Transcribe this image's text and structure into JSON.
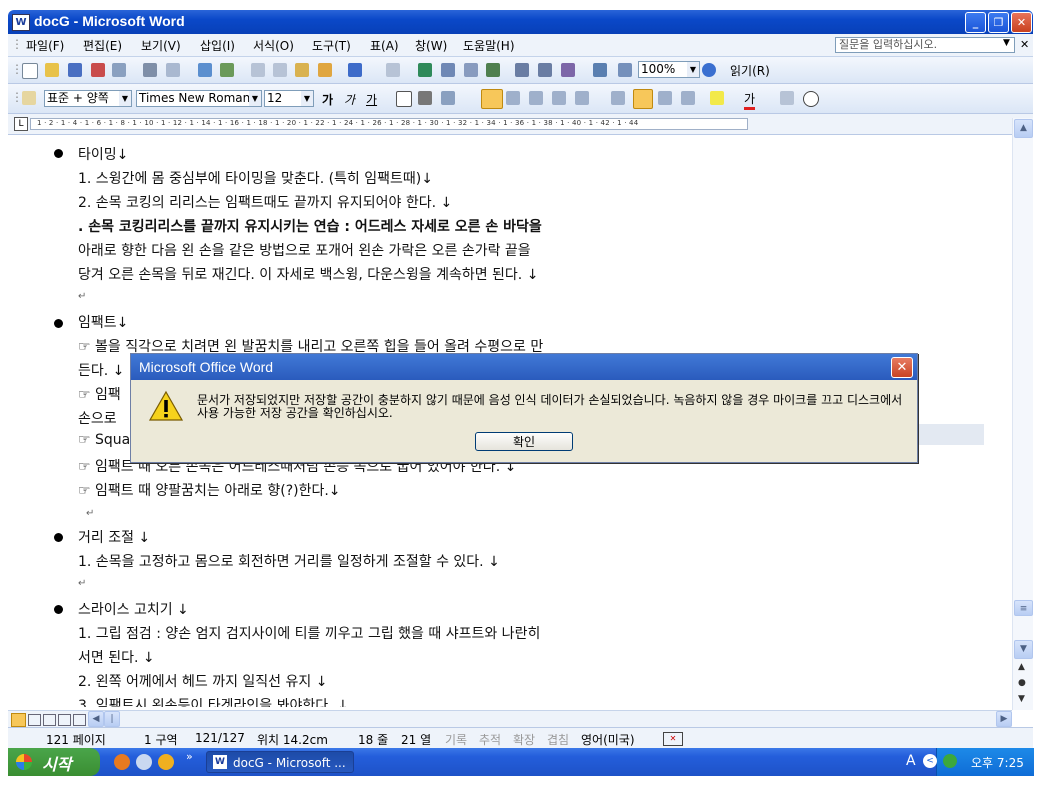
{
  "window": {
    "title": "docG - Microsoft Word",
    "app_icon": "W"
  },
  "menubar": {
    "items": [
      "파일(F)",
      "편집(E)",
      "보기(V)",
      "삽입(I)",
      "서식(O)",
      "도구(T)",
      "표(A)",
      "창(W)",
      "도움말(H)"
    ],
    "ask_placeholder": "질문을 입력하십시오."
  },
  "toolbar": {
    "zoom": "100%",
    "read_label": "읽기(R)"
  },
  "format_toolbar": {
    "style": "표준 + 양쪽",
    "font": "Times New Roman",
    "size": "12",
    "bold": "가",
    "italic": "가",
    "underline": "가",
    "highlight_label": "가"
  },
  "ruler": {
    "marks": "1 · 2 · 1 · 4 · 1 · 6 · 1 · 8 · 1 · 10 · 1 · 12 · 1 · 14 · 1 · 16 · 1 · 18 · 1 · 20 · 1 · 22 · 1 · 24 · 1 · 26 · 1 · 28 · 1 · 30 · 1 · 32 · 1 · 34 · 1 · 36 · 1 · 38 · 1 · 40 · 1 · 42 · 1 · 44"
  },
  "document": {
    "lines": [
      "타이밍↓",
      "1. 스윙간에 몸 중심부에 타이밍을 맞춘다. (특히 임팩트때)↓",
      "2. 손목 코킹의 리리스는 임팩트때도 끝까지 유지되어야 한다. ↓",
      " . 손목 코킹리리스를 끝까지 유지시키는 연습 : 어드레스 자세로 오른 손 바닥을",
      "아래로 향한 다음 왼 손을 같은 방법으로 포개어 왼손 가락은 오른 손가락 끝을",
      "당겨 오른 손목을 뒤로 재긴다. 이 자세로 백스윙, 다운스윙을 계속하면 된다.    ↓",
      "↵",
      "임팩트↓",
      "☞ 볼을 직각으로 치려면 왼 발꿈치를 내리고 오른쪽 힙을 들어 올려 수평으로 만",
      "든다. ↓",
      "☞ 임팩",
      "손으로",
      "☞ Squa",
      "☞ 임팩트 때 오른 손목은 어드레스때처럼 손등 쪽으로 굽어 있어야 한다.   ↓",
      "☞ 임팩트 때 양팔꿈치는 아래로 향(?)한다.↓",
      "↵",
      "거리 조절 ↓",
      "1. 손목을 고정하고 몸으로 회전하면 거리를 일정하게 조절할 수 있다. ↓",
      "↵",
      "스라이스 고치기 ↓",
      "1. 그립 점검 : 양손 엄지 검지사이에 티를 끼우고 그립 했을 때 샤프트와 나란히",
      "서면 된다. ↓",
      "2. 왼쪽 어께에서 헤드 까지 일직선 유지 ↓",
      "3. 임팩트시 왼손등이 타겟라인을 봐야한다. ↓"
    ]
  },
  "dialog": {
    "title": "Microsoft Office Word",
    "message": "문서가 저장되었지만 저장할 공간이 충분하지 않기 때문에 음성 인식 데이터가 손실되었습니다. 녹음하지 않을 경우 마이크를 끄고 디스크에서 사용 가능한 저장 공간을 확인하십시오.",
    "ok_label": "확인"
  },
  "statusbar": {
    "page": "121 페이지",
    "section": "1 구역",
    "page_of": "121/127",
    "position": "위치 14.2cm",
    "line": "18 줄",
    "column": "21 열",
    "rec": "기록",
    "trk": "추적",
    "ext": "확장",
    "ovr": "겹침",
    "language": "영어(미국)"
  },
  "taskbar": {
    "start_label": "시작",
    "task_label": "docG - Microsoft ...",
    "ime": "A",
    "clock": "오후 7:25"
  },
  "colors": {
    "titlebar": "#0a48c8",
    "taskbar": "#245edb",
    "start": "#3a8e32",
    "dialog_bg": "#ece9d8"
  }
}
